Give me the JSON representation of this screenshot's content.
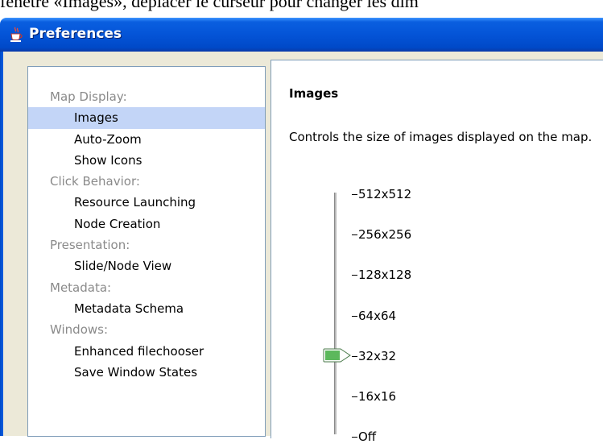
{
  "document_text": "fenêtre «Images», déplacer le curseur pour changer les dim",
  "window": {
    "title": "Preferences",
    "icon": "java-cup-icon"
  },
  "nav": {
    "items": [
      {
        "label": "Map Display:",
        "kind": "category"
      },
      {
        "label": "Images",
        "kind": "child",
        "selected": true
      },
      {
        "label": "Auto-Zoom",
        "kind": "child"
      },
      {
        "label": "Show Icons",
        "kind": "child"
      },
      {
        "label": "Click Behavior:",
        "kind": "category"
      },
      {
        "label": "Resource Launching",
        "kind": "child"
      },
      {
        "label": "Node Creation",
        "kind": "child"
      },
      {
        "label": "Presentation:",
        "kind": "category"
      },
      {
        "label": "Slide/Node View",
        "kind": "child"
      },
      {
        "label": "Metadata:",
        "kind": "category"
      },
      {
        "label": "Metadata Schema",
        "kind": "child"
      },
      {
        "label": "Windows:",
        "kind": "category"
      },
      {
        "label": "Enhanced filechooser",
        "kind": "child"
      },
      {
        "label": "Save Window States",
        "kind": "child"
      }
    ]
  },
  "content": {
    "heading": "Images",
    "description": "Controls the size of images displayed on the map.",
    "slider": {
      "ticks": [
        "512x512",
        "256x256",
        "128x128",
        "64x64",
        "32x32",
        "16x16",
        "Off"
      ],
      "selected": "32x32",
      "thumb_color": "#5cb85c"
    }
  },
  "colors": {
    "titlebar": "#0454d7",
    "selection": "#c3d5f7",
    "category_text": "#8a8a8a",
    "window_bg": "#ece9d8"
  }
}
